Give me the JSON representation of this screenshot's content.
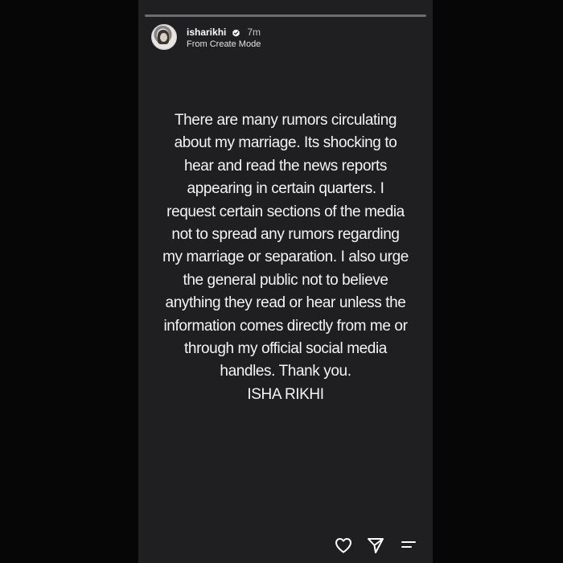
{
  "story": {
    "progress": 0.0,
    "author": {
      "username": "isharikhi",
      "verified": true,
      "time": "7m",
      "subline": "From Create Mode"
    },
    "statement_lines": [
      "There are many rumors circulating",
      "about my marriage. Its shocking to",
      "hear and read the news reports",
      "appearing in certain quarters. I",
      "request certain sections of the media",
      "not to spread any rumors regarding",
      "my marriage or separation. I also urge",
      "the general public not to believe",
      "anything they read or hear unless the",
      "information comes directly from me or",
      "through my official social media",
      "handles. Thank you.",
      "ISHA RIKHI"
    ]
  },
  "actions": {
    "like_icon": "heart-icon",
    "share_icon": "send-icon",
    "more_icon": "menu-icon"
  },
  "colors": {
    "story_background": "#1f1e21",
    "text": "#f4f4f4",
    "verified": "#ffffff"
  }
}
